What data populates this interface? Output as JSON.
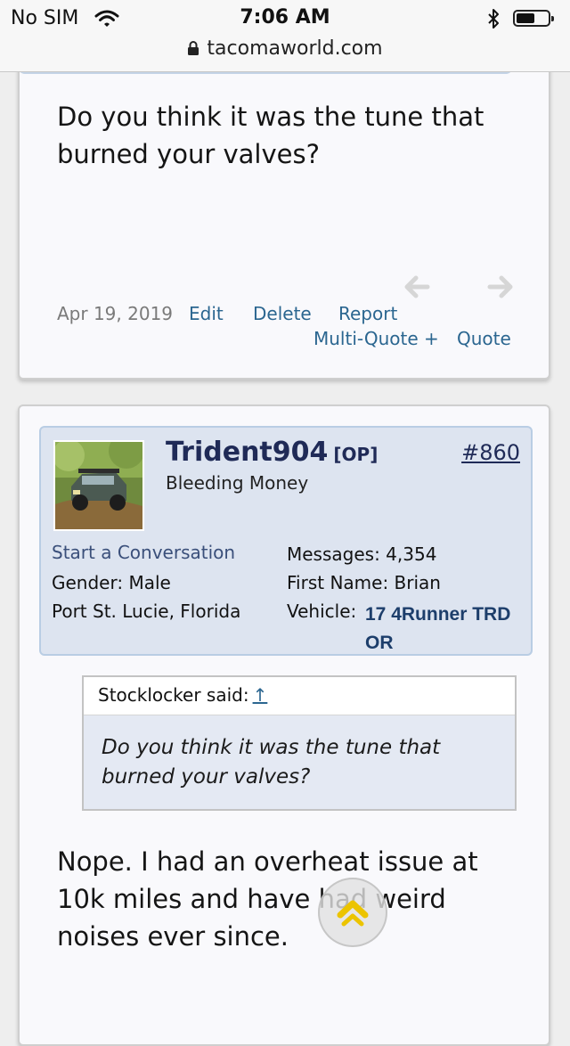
{
  "status_bar": {
    "carrier": "No SIM",
    "time": "7:06 AM",
    "url": "tacomaworld.com"
  },
  "post1": {
    "message": "Do you think it was the tune that burned your valves?",
    "date": "Apr 19, 2019",
    "actions": {
      "edit": "Edit",
      "delete": "Delete",
      "report": "Report",
      "multi_quote": "Multi-Quote +",
      "quote": "Quote"
    }
  },
  "post2": {
    "user": {
      "name": "Trident904",
      "op_tag": "[OP]",
      "title": "Bleeding Money",
      "post_number": "#860",
      "start_conversation": "Start a Conversation",
      "gender": "Gender:  Male",
      "location": "Port St. Lucie, Florida",
      "messages": "Messages:  4,354",
      "first_name": "First Name:  Brian",
      "vehicle_label": "Vehicle:",
      "vehicle": "17 4Runner TRD OR"
    },
    "quote": {
      "author": "Stocklocker said:",
      "arrow": "↑",
      "text": "Do you think it was the tune that burned your valves?"
    },
    "message": "Nope. I had an overheat issue at 10k miles and have had weird noises ever since."
  },
  "colors": {
    "link": "#2b6690",
    "username": "#1f2a57",
    "user_block_bg": "#dde4f0",
    "quote_bg": "#e4e9f3"
  },
  "icons": [
    "wifi-icon",
    "bluetooth-icon",
    "battery-icon",
    "lock-icon",
    "arrow-left-icon",
    "arrow-right-icon",
    "chevron-up-icon"
  ]
}
